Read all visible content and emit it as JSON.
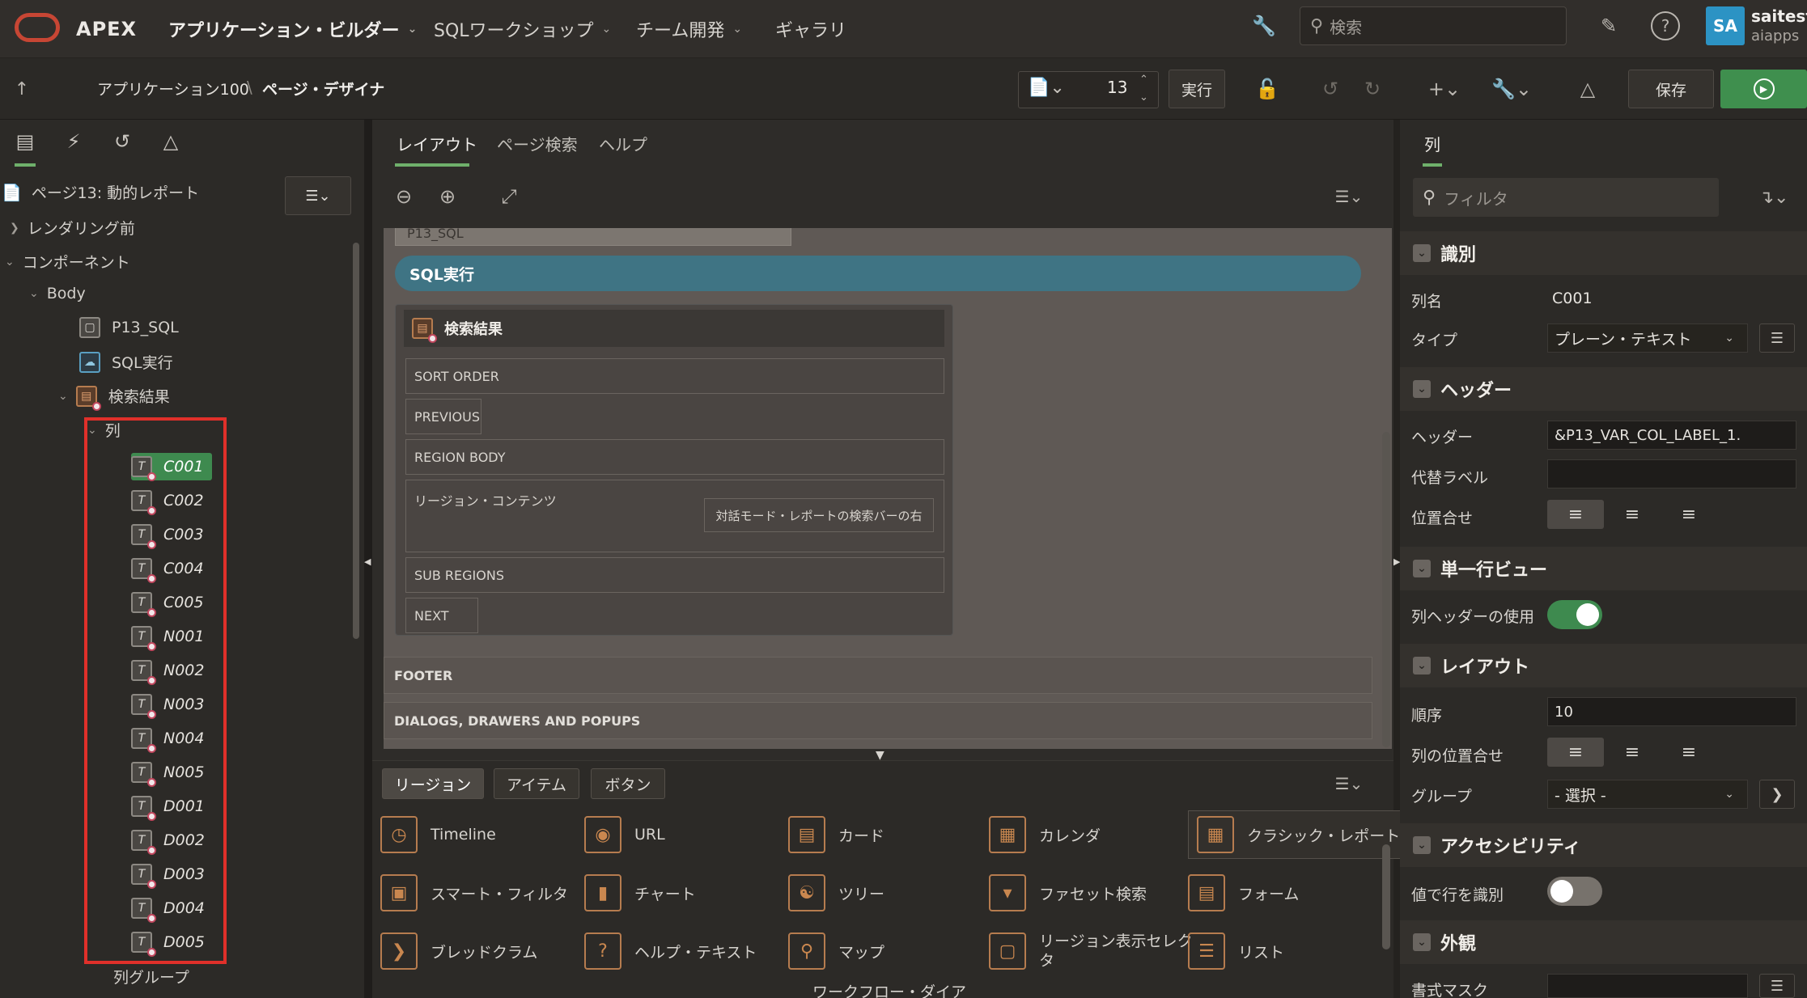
{
  "topnav": {
    "brand": "APEX",
    "items": [
      {
        "label": "アプリケーション・ビルダー",
        "chevron": true
      },
      {
        "label": "SQLワークショップ",
        "chevron": true
      },
      {
        "label": "チーム開発",
        "chevron": true
      },
      {
        "label": "ギャラリ",
        "chevron": false
      }
    ],
    "search_placeholder": "検索",
    "user": {
      "initials": "SA",
      "name": "saitest",
      "workspace": "aiapps"
    }
  },
  "subbar": {
    "breadcrumb_app": "アプリケーション100",
    "breadcrumb_sep": "\\",
    "breadcrumb_page": "ページ・デザイナ",
    "page_number": "13",
    "run_page_label": "実行",
    "save_label": "保存"
  },
  "left": {
    "page_title": "ページ13: 動的レポート",
    "tree": {
      "pre_rendering": "レンダリング前",
      "components": "コンポーネント",
      "body": "Body",
      "p13_sql": "P13_SQL",
      "sql_button": "SQL実行",
      "region": "検索結果",
      "columns_folder": "列",
      "columns": [
        "C001",
        "C002",
        "C003",
        "C004",
        "C005",
        "N001",
        "N002",
        "N003",
        "N004",
        "N005",
        "D001",
        "D002",
        "D003",
        "D004",
        "D005"
      ],
      "column_groups": "列グループ"
    }
  },
  "center": {
    "tabs": [
      "レイアウト",
      "ページ検索",
      "ヘルプ"
    ],
    "partial_item": "P13_SQL",
    "sql_button_label": "SQL実行",
    "region_title": "検索結果",
    "slots": {
      "sort_order": "SORT ORDER",
      "previous": "PREVIOUS",
      "region_body": "REGION BODY",
      "region_content": "リージョン・コンテンツ",
      "search_bar_right": "対話モード・レポートの検索バーの右",
      "sub_regions": "SUB REGIONS",
      "next": "NEXT"
    },
    "footer": "FOOTER",
    "dialogs": "DIALOGS, DRAWERS AND POPUPS"
  },
  "gallery": {
    "tabs": [
      "リージョン",
      "アイテム",
      "ボタン"
    ],
    "items": [
      [
        "Timeline",
        "URL",
        "カード",
        "カレンダ",
        "クラシック・レポート"
      ],
      [
        "スマート・フィルタ",
        "チャート",
        "ツリー",
        "ファセット検索",
        "フォーム"
      ],
      [
        "ブレッドクラム",
        "ヘルプ・テキスト",
        "マップ",
        "リージョン表示セレクタ",
        "リスト"
      ]
    ],
    "partial_row_item": "ワークフロー・ダイア"
  },
  "right": {
    "tab": "列",
    "filter_placeholder": "フィルタ",
    "sections": {
      "identification": "識別",
      "heading": "ヘッダー",
      "single_row": "単一行ビュー",
      "layout": "レイアウト",
      "accessibility": "アクセシビリティ",
      "appearance": "外観"
    },
    "props": {
      "column_name_label": "列名",
      "column_name": "C001",
      "type_label": "タイプ",
      "type": "プレーン・テキスト",
      "heading_label": "ヘッダー",
      "heading": "&P13_VAR_COL_LABEL_1.",
      "alt_label_label": "代替ラベル",
      "alt_label": "",
      "alignment_label": "位置合せ",
      "use_column_heading_label": "列ヘッダーの使用",
      "use_column_heading": true,
      "sequence_label": "順序",
      "sequence": "10",
      "column_alignment_label": "列の位置合せ",
      "group_label": "グループ",
      "group": "- 選択 -",
      "value_identifies_row_label": "値で行を識別",
      "value_identifies_row": false,
      "format_mask_label": "書式マスク"
    }
  },
  "colors": {
    "accent_green": "#3e8a4f",
    "selection_red": "#e0302a",
    "oracle_red": "#c74634",
    "button_teal": "#3f7484"
  }
}
